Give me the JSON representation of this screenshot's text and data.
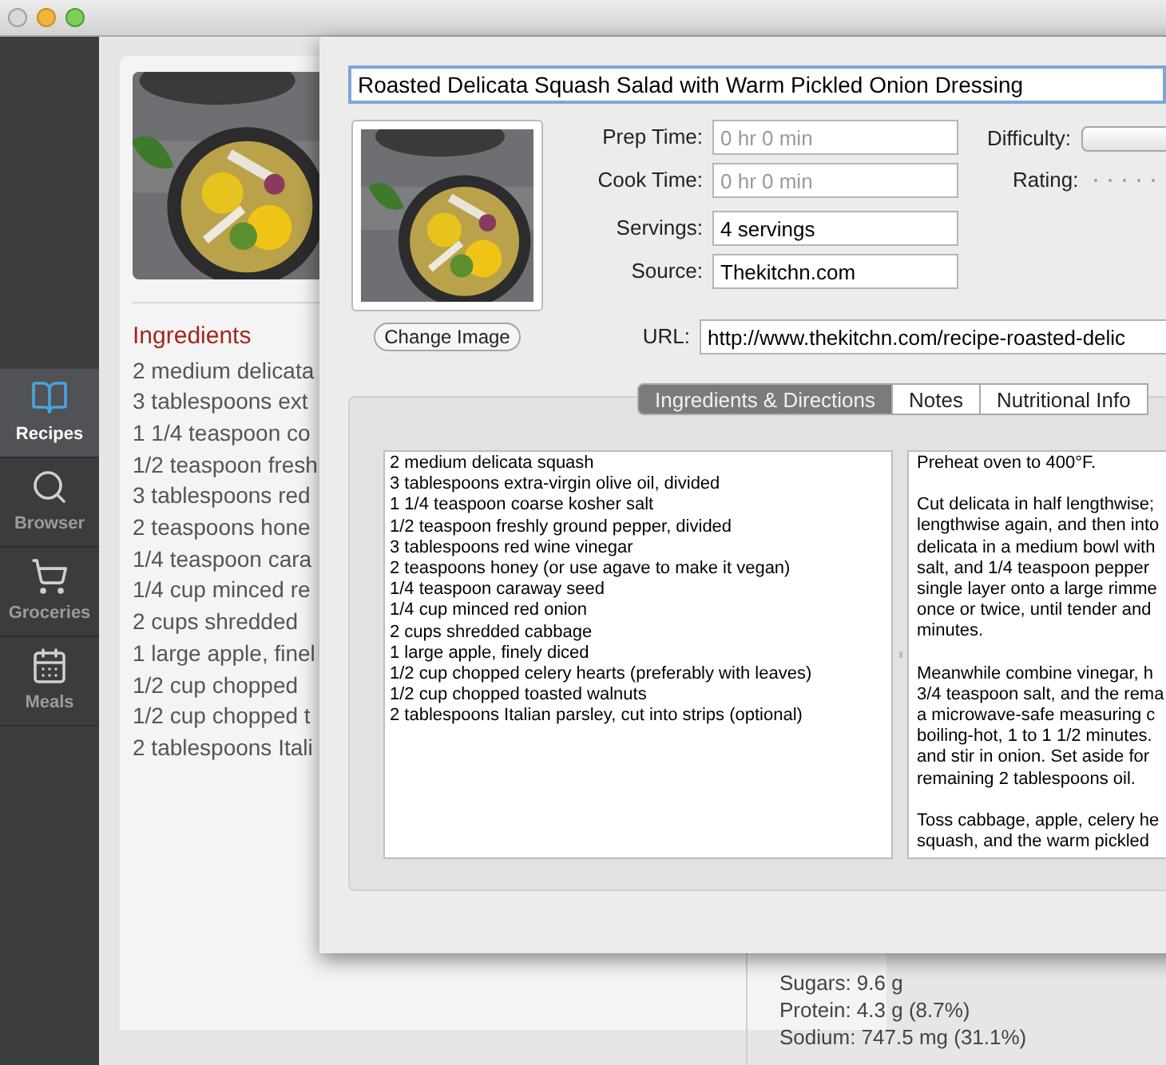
{
  "sidebar": {
    "items": [
      {
        "label": "Recipes",
        "selected": true
      },
      {
        "label": "Browser",
        "selected": false
      },
      {
        "label": "Groceries",
        "selected": false
      },
      {
        "label": "Meals",
        "selected": false
      }
    ]
  },
  "recipe_card": {
    "ingredients_heading": "Ingredients",
    "ingredients": [
      "2 medium delicata",
      "3 tablespoons ext",
      "1 1/4 teaspoon co",
      "1/2 teaspoon fresh",
      "3 tablespoons red",
      "2 teaspoons hone",
      "1/4 teaspoon cara",
      "1/4 cup minced re",
      "2 cups shredded",
      "1 large apple, finel",
      "1/2 cup chopped",
      "1/2 cup chopped t",
      "2 tablespoons Itali"
    ],
    "nutrition": [
      "Sugars: 9.6 g",
      "Protein: 4.3 g (8.7%)",
      "Sodium: 747.5 mg (31.1%)"
    ]
  },
  "edit_sheet": {
    "title_field": {
      "value": "Roasted Delicata Squash Salad with Warm Pickled Onion Dressing"
    },
    "change_image_button": "Change Image",
    "fields": [
      {
        "label": "Prep Time:",
        "placeholder": "0 hr 0 min"
      },
      {
        "label": "Cook Time:",
        "placeholder": "0 hr 0 min"
      },
      {
        "label": "Servings:",
        "value": "4 servings"
      },
      {
        "label": "Source:",
        "value": "Thekitchn.com"
      }
    ],
    "url_field": {
      "label": "URL:",
      "value": "http://www.thekitchn.com/recipe-roasted-delic"
    },
    "difficulty": {
      "label": "Difficulty:"
    },
    "rating": {
      "label": "Rating:",
      "stars": 0
    },
    "tabs": [
      {
        "label": "Ingredients & Directions",
        "selected": true
      },
      {
        "label": "Notes",
        "selected": false
      },
      {
        "label": "Nutritional Info",
        "selected": false
      }
    ],
    "ingredients_text": [
      "2 medium delicata squash",
      "3 tablespoons extra-virgin olive oil, divided",
      "1 1/4 teaspoon coarse kosher salt",
      "1/2 teaspoon freshly ground pepper, divided",
      "3 tablespoons red wine vinegar",
      "2 teaspoons honey (or use agave to make it vegan)",
      "1/4 teaspoon caraway seed",
      "1/4 cup minced red onion",
      "2 cups shredded cabbage",
      "1 large apple, finely diced",
      "1/2 cup chopped celery hearts (preferably with leaves)",
      "1/2 cup chopped toasted walnuts",
      "2 tablespoons Italian parsley, cut into strips (optional)"
    ],
    "directions_text": [
      [
        "Preheat oven to 400°F."
      ],
      [
        "Cut delicata in half lengthwise;",
        "lengthwise again, and then into",
        "delicata in a medium bowl with",
        "salt, and 1/4 teaspoon pepper",
        "single layer onto a large rimme",
        "once or twice, until tender and",
        "minutes."
      ],
      [
        "Meanwhile combine vinegar, h",
        "3/4 teaspoon salt, and the rema",
        "a microwave-safe measuring c",
        "boiling-hot, 1 to 1 1/2 minutes.",
        "and stir in onion. Set aside for",
        "remaining 2 tablespoons oil."
      ],
      [
        "Toss cabbage, apple, celery he",
        "squash, and the warm pickled"
      ]
    ]
  }
}
